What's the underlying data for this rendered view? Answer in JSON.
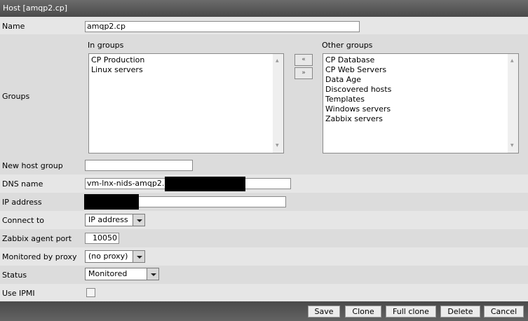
{
  "header": {
    "title": "Host  [amqp2.cp]"
  },
  "form": {
    "name": {
      "label": "Name",
      "value": "amqp2.cp"
    },
    "groups": {
      "label": "Groups",
      "in_label": "In groups",
      "other_label": "Other groups",
      "in_groups": [
        "CP Production",
        "Linux servers"
      ],
      "other_groups": [
        "CP Database",
        "CP Web Servers",
        "Data Age",
        "Discovered hosts",
        "Templates",
        "Windows servers",
        "Zabbix servers"
      ],
      "move_left": "«",
      "move_right": "»"
    },
    "new_host_group": {
      "label": "New host group",
      "value": ""
    },
    "dns": {
      "label": "DNS name",
      "value": "vm-lnx-nids-amqp2."
    },
    "ip": {
      "label": "IP address",
      "value": ""
    },
    "connect_to": {
      "label": "Connect to",
      "value": "IP address"
    },
    "port": {
      "label": "Zabbix agent port",
      "value": "10050"
    },
    "proxy": {
      "label": "Monitored by proxy",
      "value": "(no proxy)"
    },
    "status": {
      "label": "Status",
      "value": "Monitored"
    },
    "ipmi": {
      "label": "Use IPMI",
      "checked": false
    }
  },
  "buttons": {
    "save": "Save",
    "clone": "Clone",
    "full_clone": "Full clone",
    "delete": "Delete",
    "cancel": "Cancel"
  }
}
